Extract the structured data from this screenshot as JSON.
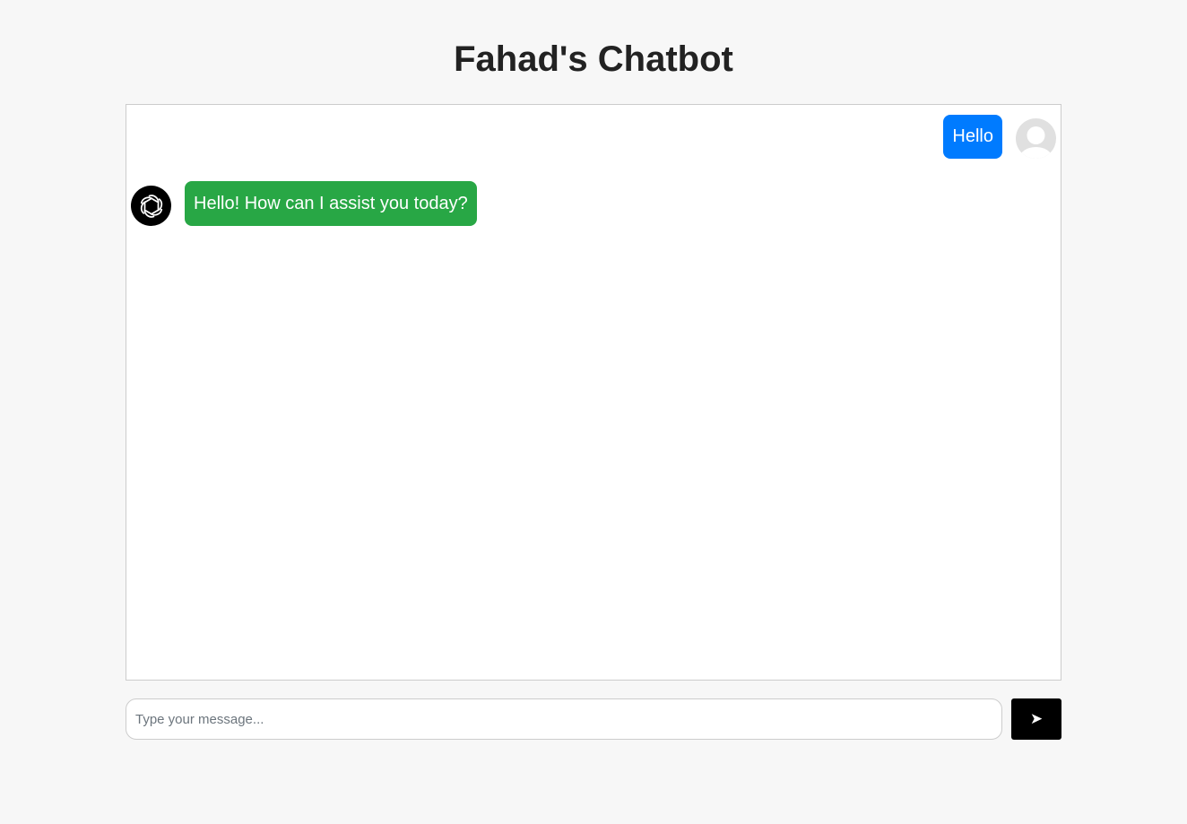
{
  "header": {
    "title": "Fahad's Chatbot"
  },
  "messages": [
    {
      "role": "user",
      "text": "Hello",
      "avatar_icon": "user-silhouette-icon"
    },
    {
      "role": "bot",
      "text": "Hello! How can I assist you today?",
      "avatar_icon": "openai-logo-icon"
    }
  ],
  "composer": {
    "placeholder": "Type your message...",
    "value": "",
    "send_label": "➤"
  },
  "colors": {
    "user_bubble": "#007bff",
    "bot_bubble": "#28a745",
    "send_button": "#000000"
  }
}
